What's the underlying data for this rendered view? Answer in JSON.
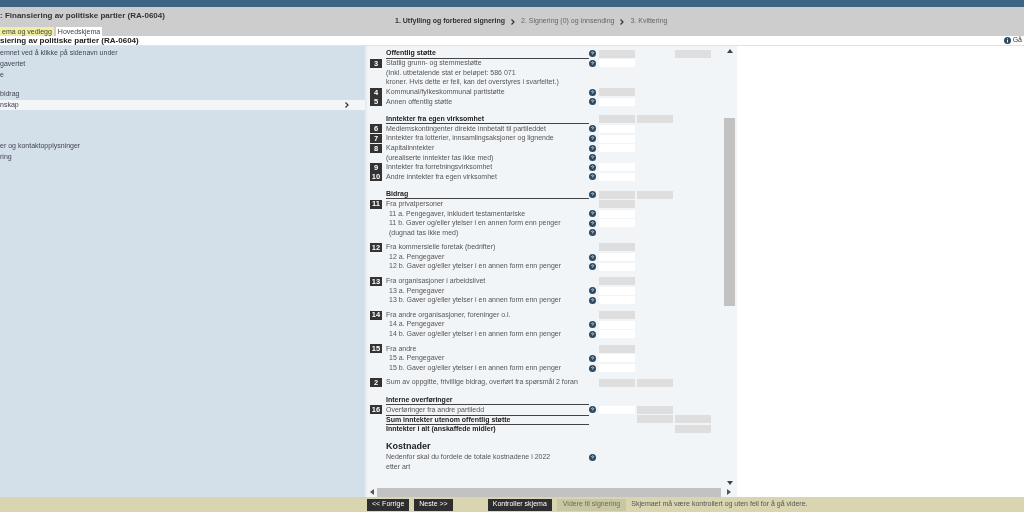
{
  "header": {
    "title": ": Finansiering av politiske partier (RA-0604)",
    "tabs": [
      {
        "label": "ema og vedlegg",
        "selected": false
      },
      {
        "label": "Hovedskjema",
        "selected": true
      }
    ],
    "steps": [
      {
        "label": "1. Utfylling og forbered signering",
        "selected": true
      },
      {
        "label": "2. Signering (0) og innsending",
        "selected": false
      },
      {
        "label": "3. Kvittering",
        "selected": false
      }
    ]
  },
  "subheader": {
    "title": "siering av politiske partier (RA-0604)",
    "help_link": "Gå"
  },
  "sidebar": {
    "items": [
      {
        "label": "emnet ved å klikke på sidenavn under",
        "selected": false
      },
      {
        "label": "gavertet",
        "selected": false
      },
      {
        "label": "e",
        "selected": false
      },
      {
        "label": "bidrag",
        "selected": false
      },
      {
        "label": "nskap",
        "selected": true
      },
      {
        "label": "er og kontaktopplysninger",
        "selected": false
      },
      {
        "label": "ring",
        "selected": false
      }
    ]
  },
  "form": {
    "rows": [
      {
        "kind": "section",
        "label": "Offentlig støtte",
        "help": true,
        "cells": [
          {
            "kind": "readonly"
          },
          {
            "kind": "blank"
          },
          {
            "kind": "readonly"
          }
        ]
      },
      {
        "kind": "line",
        "number": "3",
        "label": "Statlig grunn- og stemmestøtte",
        "help": true,
        "cells": [
          {
            "kind": "input"
          }
        ]
      },
      {
        "kind": "line",
        "label": "(Inkl. utbetalende stat er beløpet: 586 071",
        "help": false,
        "cells": []
      },
      {
        "kind": "line",
        "label": "kroner. Hvis dette er feil, kan det overstyres i svarfeltet.)",
        "help": false,
        "cells": []
      },
      {
        "kind": "line",
        "number": "4",
        "label": "Kommunal/fylkeskommunal partistøtte",
        "help": true,
        "cells": [
          {
            "kind": "readonly"
          }
        ]
      },
      {
        "kind": "line",
        "number": "5",
        "label": "Annen offentlig støtte",
        "help": true,
        "cells": [
          {
            "kind": "input"
          }
        ]
      },
      {
        "kind": "section",
        "label": "Inntekter fra egen virksomhet",
        "help": false,
        "cells": [
          {
            "kind": "readonly"
          },
          {
            "kind": "readonly"
          }
        ]
      },
      {
        "kind": "line",
        "number": "6",
        "label": "Medlemskontingenter direkte innbetalt til partileddet",
        "help": true,
        "cells": [
          {
            "kind": "input"
          }
        ]
      },
      {
        "kind": "line",
        "number": "7",
        "label": "Inntekter fra lotterier, innsamlingsaksjoner og lignende",
        "help": true,
        "cells": [
          {
            "kind": "input"
          }
        ]
      },
      {
        "kind": "line",
        "number": "8",
        "label": "Kapitalinntekter",
        "help": true,
        "cells": [
          {
            "kind": "input"
          }
        ]
      },
      {
        "kind": "line",
        "label": "(urealiserte inntekter tas ikke med)",
        "help": true,
        "cells": []
      },
      {
        "kind": "line",
        "number": "9",
        "label": "Inntekter fra forretningsvirksomhet",
        "help": true,
        "cells": [
          {
            "kind": "input"
          }
        ]
      },
      {
        "kind": "line",
        "number": "10",
        "label": "Andre inntekter fra egen virksomhet",
        "help": true,
        "cells": [
          {
            "kind": "input"
          }
        ]
      },
      {
        "kind": "section",
        "label": "Bidrag",
        "help": true,
        "cells": [
          {
            "kind": "readonly"
          },
          {
            "kind": "readonly"
          }
        ]
      },
      {
        "kind": "line",
        "number": "11",
        "label": "Fra privatpersoner",
        "help": false,
        "cells": [
          {
            "kind": "readonly"
          }
        ]
      },
      {
        "kind": "sub",
        "label": "11 a. Pengegaver, inkludert testamentariske",
        "help": true,
        "cells": [
          {
            "kind": "input"
          }
        ]
      },
      {
        "kind": "sub",
        "label": "11 b. Gaver og/eller ytelser i en annen form enn penger",
        "help": true,
        "cells": [
          {
            "kind": "input"
          }
        ]
      },
      {
        "kind": "sub",
        "label": "(dugnad tas ikke med)",
        "help": true,
        "cells": []
      },
      {
        "kind": "group",
        "number": "12",
        "label": "Fra kommersielle foretak (bedrifter)",
        "help": false,
        "cells": [
          {
            "kind": "readonly"
          }
        ]
      },
      {
        "kind": "sub",
        "label": "12 a. Pengegaver",
        "help": true,
        "cells": [
          {
            "kind": "input"
          }
        ]
      },
      {
        "kind": "sub",
        "label": "12 b. Gaver og/eller ytelser i en annen form enn penger",
        "help": true,
        "cells": [
          {
            "kind": "input"
          }
        ]
      },
      {
        "kind": "group",
        "number": "13",
        "label": "Fra organisasjoner i arbeidslivet",
        "help": false,
        "cells": [
          {
            "kind": "readonly"
          }
        ]
      },
      {
        "kind": "sub",
        "label": "13 a. Pengegaver",
        "help": true,
        "cells": [
          {
            "kind": "input"
          }
        ]
      },
      {
        "kind": "sub",
        "label": "13 b. Gaver og/eller ytelser i en annen form enn penger",
        "help": true,
        "cells": [
          {
            "kind": "input"
          }
        ]
      },
      {
        "kind": "group",
        "number": "14",
        "label": "Fra andre organisasjoner, foreninger o.l.",
        "help": false,
        "cells": [
          {
            "kind": "readonly"
          }
        ]
      },
      {
        "kind": "sub",
        "label": "14 a. Pengegaver",
        "help": true,
        "cells": [
          {
            "kind": "input"
          }
        ]
      },
      {
        "kind": "sub",
        "label": "14 b. Gaver og/eller ytelser i en annen form enn penger",
        "help": true,
        "cells": [
          {
            "kind": "input"
          }
        ]
      },
      {
        "kind": "group",
        "number": "15",
        "label": "Fra andre",
        "help": false,
        "cells": [
          {
            "kind": "readonly"
          }
        ]
      },
      {
        "kind": "sub",
        "label": "15 a. Pengegaver",
        "help": true,
        "cells": [
          {
            "kind": "input"
          }
        ]
      },
      {
        "kind": "sub",
        "label": "15 b. Gaver og/eller ytelser i en annen form enn penger",
        "help": true,
        "cells": [
          {
            "kind": "input"
          }
        ]
      },
      {
        "kind": "group",
        "number": "2",
        "label": "Sum av oppgitte, frivillige bidrag, overført fra spørsmål 2 foran",
        "help": false,
        "cells": [
          {
            "kind": "readonly"
          },
          {
            "kind": "readonly"
          }
        ]
      },
      {
        "kind": "section",
        "label": "Interne overføringer",
        "help": false,
        "cells": []
      },
      {
        "kind": "line",
        "number": "16",
        "label": "Overføringer fra andre partiledd",
        "help": true,
        "cells": [
          {
            "kind": "input"
          },
          {
            "kind": "readonly"
          }
        ]
      },
      {
        "kind": "total",
        "label": "Sum inntekter utenom offentlig støtte",
        "help": false,
        "cells": [
          {
            "kind": "blank"
          },
          {
            "kind": "readonly"
          },
          {
            "kind": "readonly"
          }
        ]
      },
      {
        "kind": "total",
        "label": "Inntekter i alt (anskaffede midler)",
        "help": false,
        "cells": [
          {
            "kind": "blank"
          },
          {
            "kind": "blank"
          },
          {
            "kind": "readonly"
          }
        ]
      },
      {
        "kind": "heading",
        "label": "Kostnader",
        "help": false,
        "cells": []
      },
      {
        "kind": "line",
        "label": "Nedenfor skal du fordele de totale kostnadene i 2022",
        "help": true,
        "cells": []
      },
      {
        "kind": "line",
        "label": "etter art",
        "help": false,
        "cells": []
      }
    ]
  },
  "footer": {
    "buttons": [
      {
        "label": "<< Forrige",
        "disabled": false
      },
      {
        "label": "Neste >>",
        "disabled": false
      },
      {
        "label": "Kontroller skjema",
        "disabled": false
      },
      {
        "label": "Videre til signering",
        "disabled": true
      }
    ],
    "message": "Skjemaet må være kontrollert og uten feil for å gå videre."
  }
}
